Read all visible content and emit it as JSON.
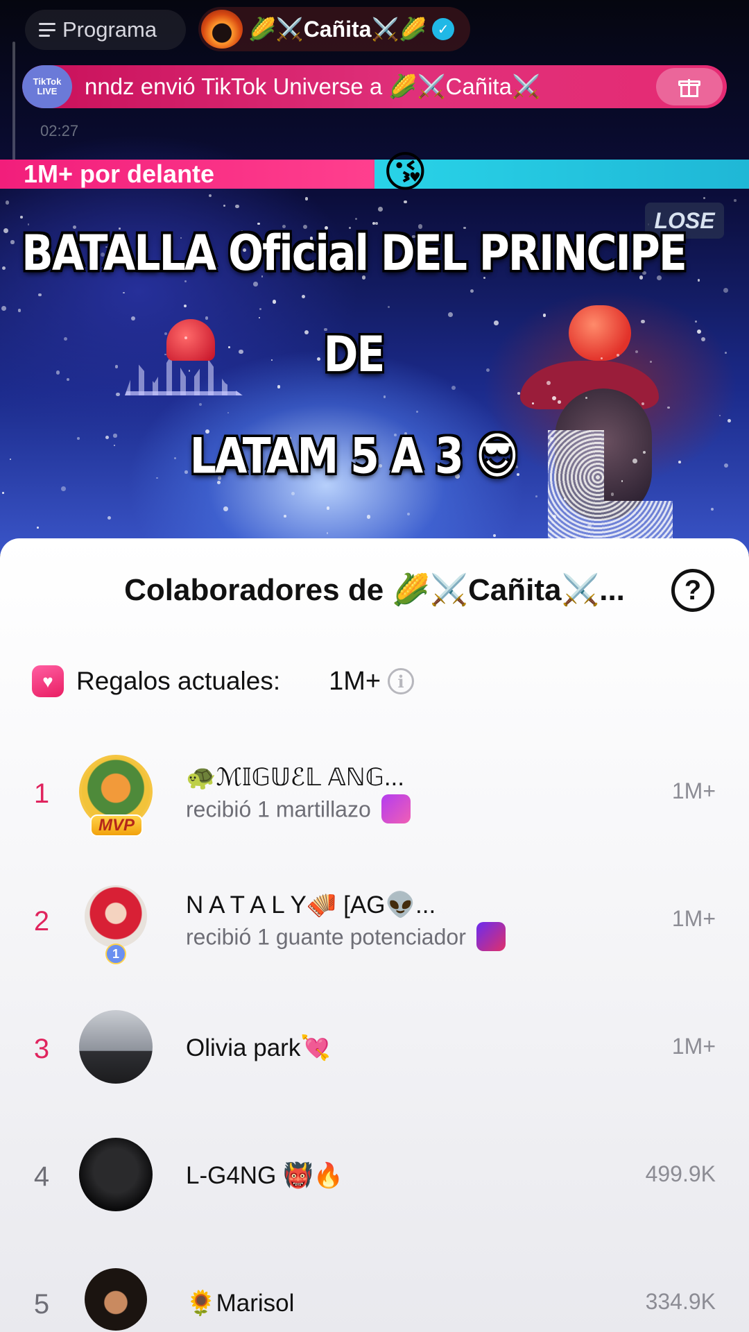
{
  "top_bar": {
    "programa_label": "Programa",
    "host_name": "🌽⚔️Cañita⚔️🌽",
    "verified_mark": "✓"
  },
  "gift_banner": {
    "logo_text": "TikTok LIVE",
    "text": "nndz envió TikTok Universe a 🌽⚔️Cañita⚔️"
  },
  "timer": "02:27",
  "battle": {
    "lead_label": "1M+ por delante",
    "emoji": "😘",
    "lose_label": "LOSE",
    "left_color": "#f21e7b",
    "right_color": "#29d3e8"
  },
  "caption": {
    "line1": "BATALLA Oficial DEL  PRINCIPE DE",
    "line2": "LATAM  5 A 3 😎"
  },
  "sheet": {
    "title": "Colaboradores de  🌽⚔️Cañita⚔️...",
    "help_label": "?",
    "current_gifts_label": "Regalos actuales:",
    "current_gifts_value": "1M+",
    "info_label": "i",
    "rank_color": "#e0245e"
  },
  "contributors": [
    {
      "rank": "1",
      "name": "🐢ℳ𝕀𝔾𝕌ℰ𝕃 𝔸ℕ𝔾...",
      "sub": "recibió 1 martillazo",
      "value": "1M+",
      "badge": "MVP"
    },
    {
      "rank": "2",
      "name": "N A T A L Y🪗  [AG👽...",
      "sub": "recibió 1 guante potenciador",
      "value": "1M+",
      "badge": "1"
    },
    {
      "rank": "3",
      "name": "Olivia park💘",
      "sub": "",
      "value": "1M+"
    },
    {
      "rank": "4",
      "name": "L-G4NG 👹🔥",
      "sub": "",
      "value": "499.9K"
    },
    {
      "rank": "5",
      "name": "🌻Marisol",
      "sub": "",
      "value": "334.9K"
    }
  ]
}
